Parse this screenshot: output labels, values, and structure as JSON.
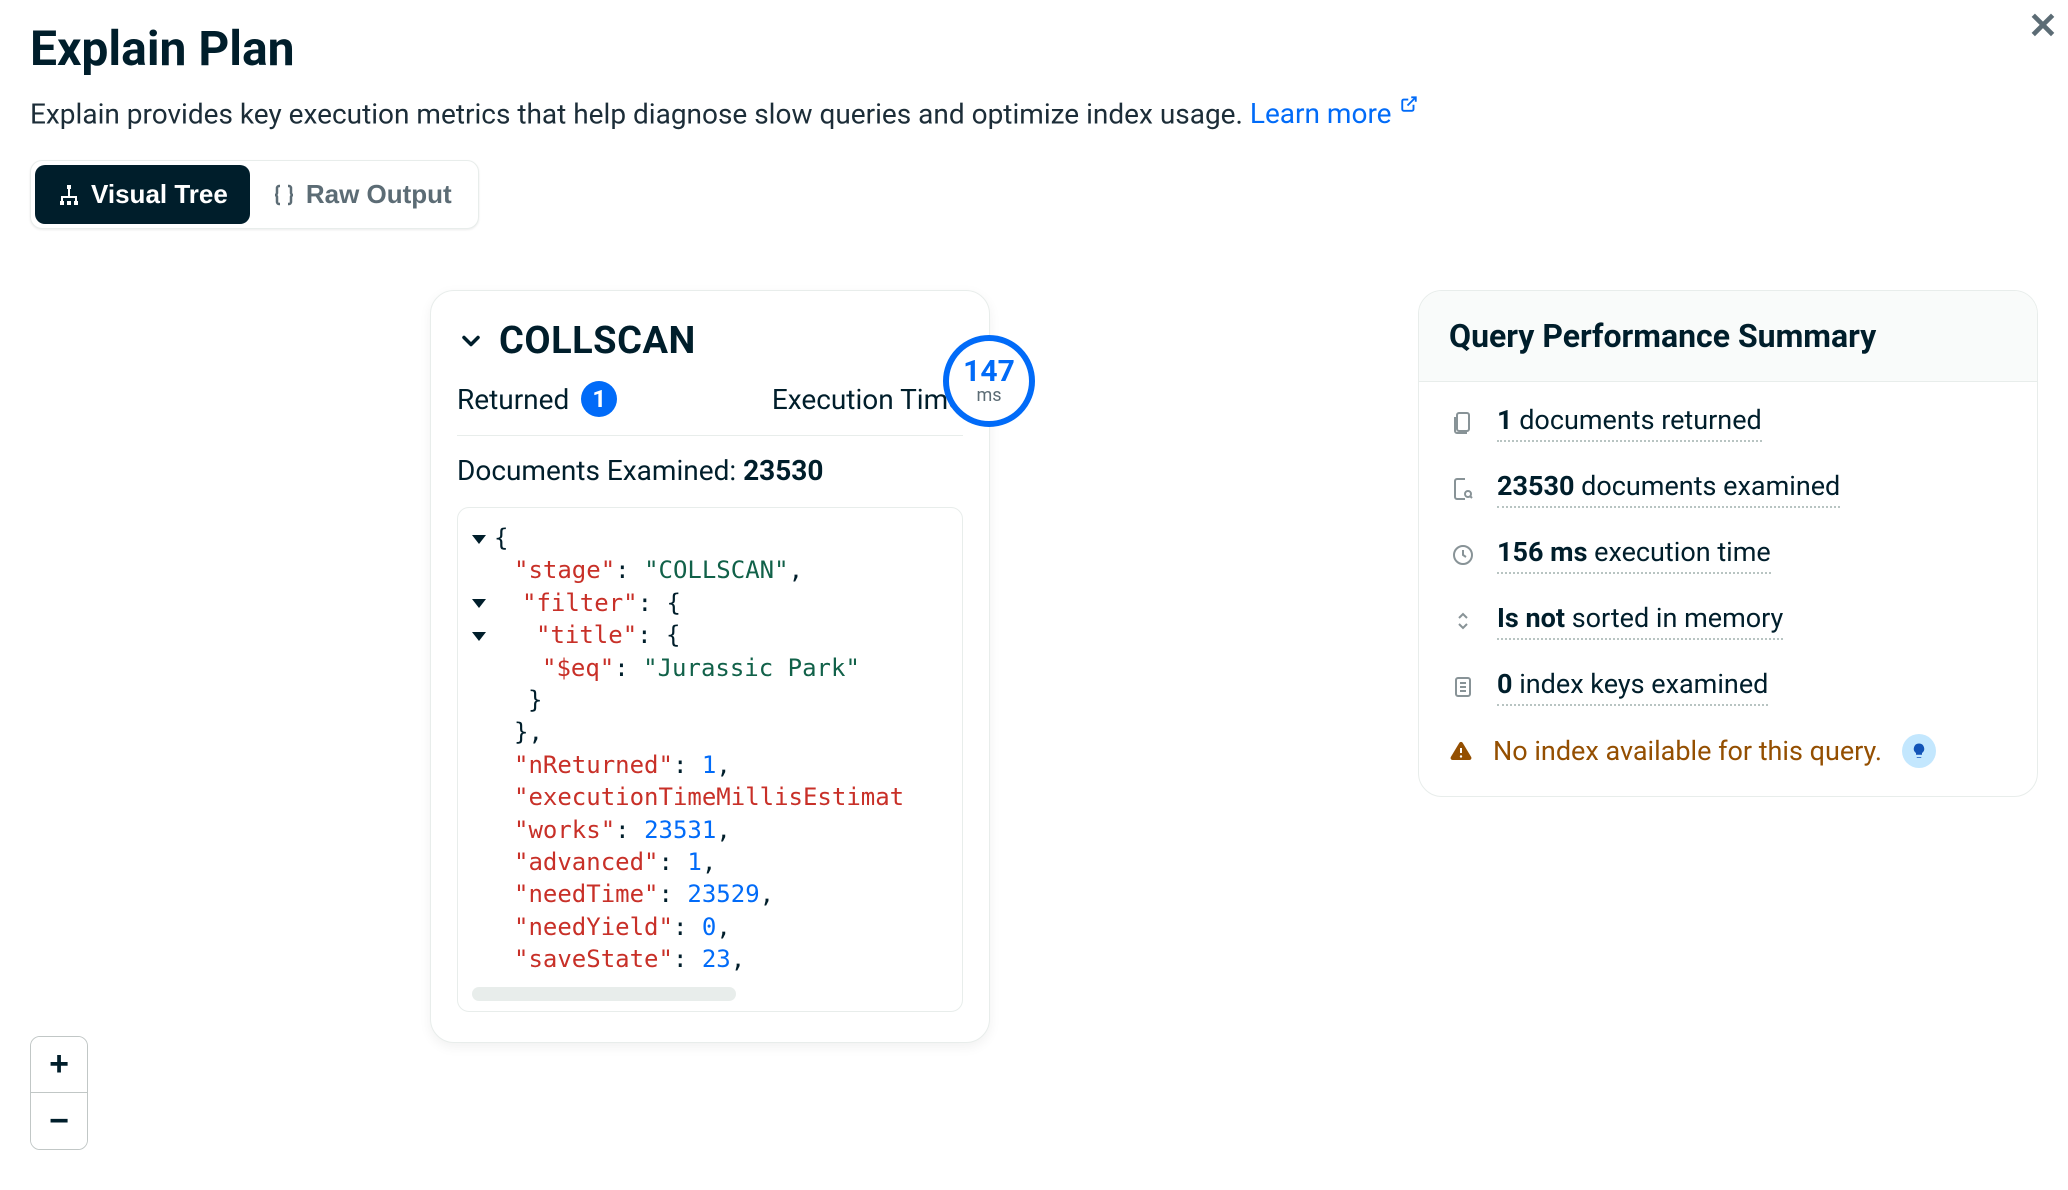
{
  "header": {
    "title": "Explain Plan",
    "subtitle": "Explain provides key execution metrics that help diagnose slow queries and optimize index usage. ",
    "learn_more": "Learn more"
  },
  "tabs": {
    "visual": "Visual Tree",
    "raw": "Raw Output"
  },
  "stage": {
    "name": "COLLSCAN",
    "returned_label": "Returned",
    "returned_value": "1",
    "exec_label": "Execution Time",
    "exec_value": "147",
    "exec_unit": "ms",
    "docs_examined_label": "Documents Examined: ",
    "docs_examined_value": "23530",
    "json": {
      "stage_key": "\"stage\"",
      "stage_val": "\"COLLSCAN\"",
      "filter_key": "\"filter\"",
      "title_key": "\"title\"",
      "eq_key": "\"$eq\"",
      "eq_val": "\"Jurassic Park\"",
      "nReturned_key": "\"nReturned\"",
      "nReturned_val": "1",
      "etme_key": "\"executionTimeMillisEstimat",
      "works_key": "\"works\"",
      "works_val": "23531",
      "advanced_key": "\"advanced\"",
      "advanced_val": "1",
      "needTime_key": "\"needTime\"",
      "needTime_val": "23529",
      "needYield_key": "\"needYield\"",
      "needYield_val": "0",
      "saveState_key": "\"saveState\"",
      "saveState_val": "23"
    }
  },
  "summary": {
    "title": "Query Performance Summary",
    "rows": {
      "returned_b": "1",
      "returned_t": " documents returned",
      "examined_b": "23530",
      "examined_t": " documents examined",
      "time_b": "156 ms",
      "time_t": " execution time",
      "sort_b": "Is not",
      "sort_t": " sorted in memory",
      "idx_b": "0",
      "idx_t": " index keys examined"
    },
    "warning": "No index available for this query."
  },
  "zoom": {
    "in": "+",
    "out": "−"
  }
}
